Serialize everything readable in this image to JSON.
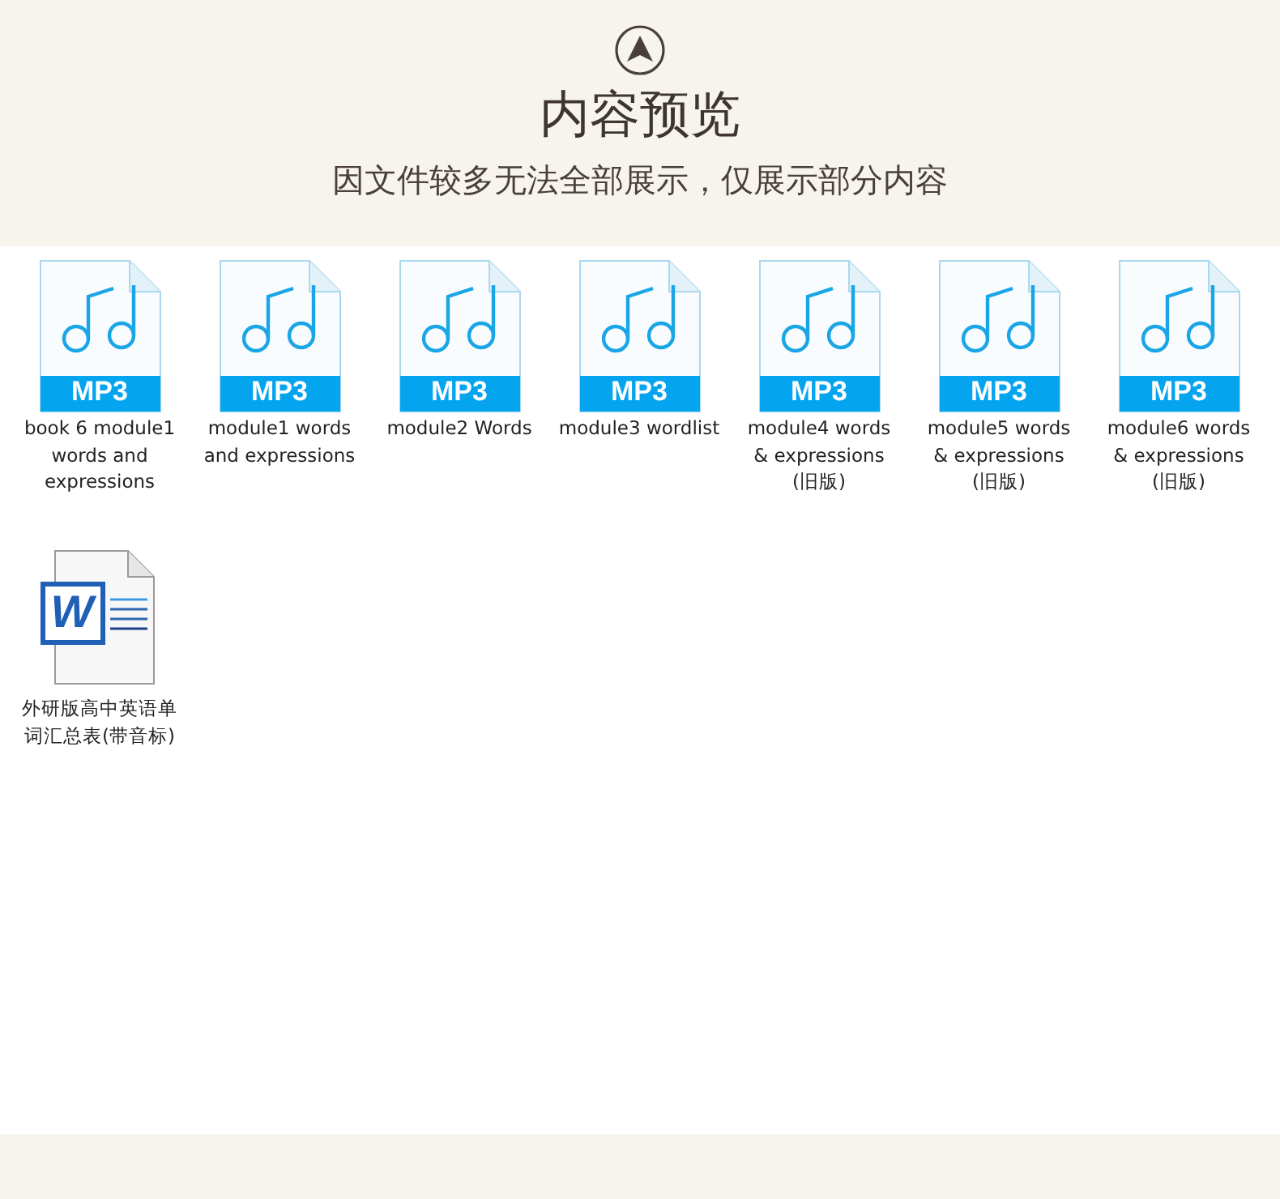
{
  "header": {
    "title": "内容预览",
    "subtitle": "因文件较多无法全部展示，仅展示部分内容"
  },
  "files": [
    {
      "kind": "mp3",
      "badge": "MP3",
      "name": "book 6 module1 words and expressions"
    },
    {
      "kind": "mp3",
      "badge": "MP3",
      "name": "module1 words and expressions"
    },
    {
      "kind": "mp3",
      "badge": "MP3",
      "name": "module2 Words"
    },
    {
      "kind": "mp3",
      "badge": "MP3",
      "name": "module3 wordlist"
    },
    {
      "kind": "mp3",
      "badge": "MP3",
      "name": "module4 words & expressions (旧版)"
    },
    {
      "kind": "mp3",
      "badge": "MP3",
      "name": "module5 words & expressions (旧版)"
    },
    {
      "kind": "mp3",
      "badge": "MP3",
      "name": "module6 words & expressions (旧版)"
    },
    {
      "kind": "word",
      "badge": "W",
      "name": "外研版高中英语单词汇总表(带音标)"
    }
  ]
}
